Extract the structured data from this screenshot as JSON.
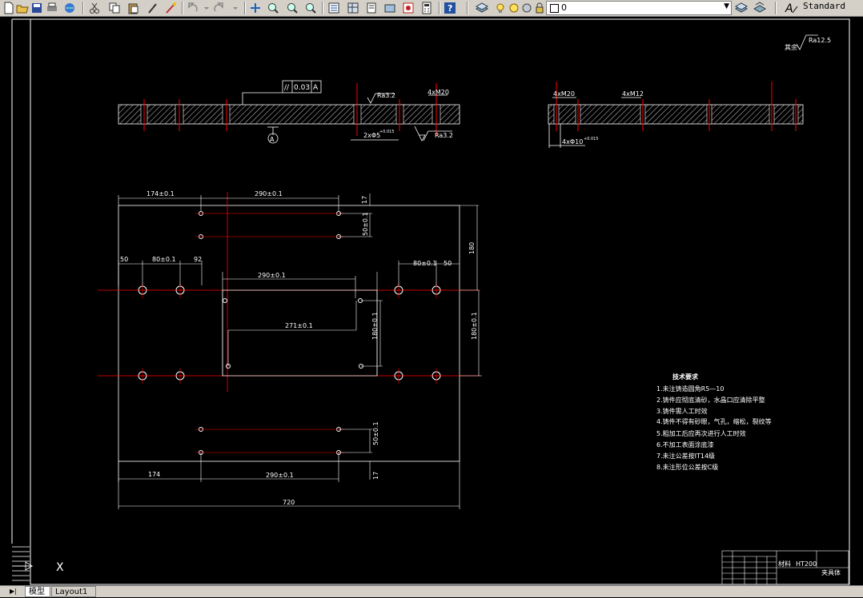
{
  "toolbar": {
    "layer_value": "0",
    "text_style": "Standard",
    "icons": [
      "new-icon",
      "open-icon",
      "save-icon",
      "plot-icon",
      "cut-icon",
      "copy-icon",
      "paste-icon",
      "match-properties-icon",
      "brush-icon",
      "undo-icon",
      "redo-icon",
      "pan-icon",
      "zoom-realtime-icon",
      "zoom-window-icon",
      "zoom-previous-icon",
      "properties-icon",
      "design-center-icon",
      "tool-palettes-icon",
      "sheet-set-icon",
      "markup-icon",
      "calculator-icon",
      "help-icon",
      "layer-manager-icon",
      "layer-state-icon",
      "text-style-icon"
    ]
  },
  "drawing": {
    "roughness_global": "Ra12.5",
    "roughness_prefix": "其余",
    "flatness_tol": "//",
    "flatness_value": "0.03",
    "datum_label": "A",
    "datum_marker": "A",
    "roughness_1": "Ra3.2",
    "roughness_2": "Ra3.2",
    "hole_note_1": "4xM20",
    "hole_note_2": "2xΦ5",
    "hole_tol_2": "+0.015",
    "hole_note_3": "4xM12",
    "hole_note_4": "4xΦ10",
    "hole_tol_4": "+0.015",
    "dims": {
      "d_174_top": "174±0.1",
      "d_290_top": "290±0.1",
      "d_17_top": "17",
      "d_50_right": "50±0.1",
      "d_180_right": "180",
      "d_50_left": "50",
      "d_80_left": "80±0.1",
      "d_92": "92",
      "d_80_right": "80±0.1",
      "d_50_rr": "50",
      "d_290_mid": "290±0.1",
      "d_271": "271±0.1",
      "d_180_mid": "180±0.1",
      "d_180_far": "180±0.1",
      "d_50_bottom": "50±0.1",
      "d_174_bottom": "174",
      "d_290_bottom": "290±0.1",
      "d_17_bottom": "17",
      "d_720": "720"
    },
    "notes": {
      "title": "技术要求",
      "items": [
        "1.未注铸造圆角R5—10",
        "2.铸件应彻底清砂，水晶口应清除平整",
        "3.铸件需人工时效",
        "4.铸件不得有砂眼，气孔，缩松，裂纹等",
        "5.粗加工后应再次进行人工时效",
        "6.不加工表面涂底漆",
        "7.未注公差按IT14级",
        "8.未注形位公差按C级"
      ]
    },
    "title_block": {
      "material_label": "材料",
      "material_value": "HT200",
      "part_name": "夹具体"
    },
    "ucs_x": "X"
  },
  "tabs": {
    "model": "模型",
    "layout1": "Layout1",
    "nav": "▶|"
  },
  "colors": {
    "background": "#000000",
    "geometry": "#ffffff",
    "center_lines": "#ff0000",
    "ui_gray": "#d4d0c8"
  }
}
